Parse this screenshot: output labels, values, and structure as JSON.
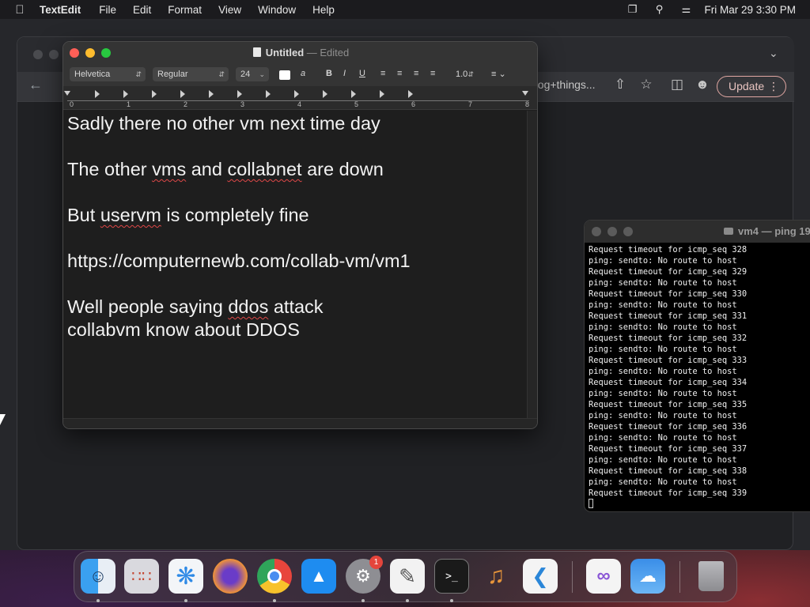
{
  "menubar": {
    "app_name": "TextEdit",
    "menus": [
      "File",
      "Edit",
      "Format",
      "View",
      "Window",
      "Help"
    ],
    "clock": "Fri Mar 29  3:30 PM"
  },
  "browser": {
    "omnibox_tail": "nog+things...",
    "update_label": "Update"
  },
  "textedit": {
    "title": "Untitled",
    "title_sep": " — ",
    "title_status": "Edited",
    "format_bar": {
      "font_family": "Helvetica",
      "font_style": "Regular",
      "font_size": "24",
      "line_spacing": "1.0"
    },
    "ruler_numbers": [
      "0",
      "1",
      "2",
      "3",
      "4",
      "5",
      "6",
      "7",
      "8"
    ],
    "lines": {
      "l1": "Sadly there no other vm next time day",
      "l2_pre": "The other ",
      "l2_w1": "vms",
      "l2_mid": " and ",
      "l2_w2": "collabnet",
      "l2_post": " are down",
      "l3_pre": "But ",
      "l3_w1": "uservm",
      "l3_post": " is completely fine",
      "l4": "https://computernewb.com/collab-vm/vm1",
      "l5_pre": "Well people saying ",
      "l5_w1": "ddos",
      "l5_post": " attack",
      "l6": "collabvm know about DDOS"
    }
  },
  "terminal": {
    "title": "vm4 — ping 19",
    "lines": [
      "Request timeout for icmp_seq 328",
      "ping: sendto: No route to host",
      "Request timeout for icmp_seq 329",
      "ping: sendto: No route to host",
      "Request timeout for icmp_seq 330",
      "ping: sendto: No route to host",
      "Request timeout for icmp_seq 331",
      "ping: sendto: No route to host",
      "Request timeout for icmp_seq 332",
      "ping: sendto: No route to host",
      "Request timeout for icmp_seq 333",
      "ping: sendto: No route to host",
      "Request timeout for icmp_seq 334",
      "ping: sendto: No route to host",
      "Request timeout for icmp_seq 335",
      "ping: sendto: No route to host",
      "Request timeout for icmp_seq 336",
      "ping: sendto: No route to host",
      "Request timeout for icmp_seq 337",
      "ping: sendto: No route to host",
      "Request timeout for icmp_seq 338",
      "ping: sendto: No route to host",
      "Request timeout for icmp_seq 339"
    ]
  },
  "dock": {
    "apps": [
      "finder-icon",
      "launchpad-icon",
      "safari-icon",
      "firefox-icon",
      "chrome-icon",
      "app-store-icon",
      "system-settings-icon",
      "textedit-icon",
      "terminal-icon",
      "garageband-icon",
      "vscode-icon",
      "visual-studio-icon",
      "weather-icon",
      "trash-icon"
    ],
    "settings_badge": "1"
  },
  "colors": {
    "close": "#ff5f57",
    "minimize": "#febc2e",
    "zoom": "#28c840",
    "spell_underline": "#e04848"
  }
}
